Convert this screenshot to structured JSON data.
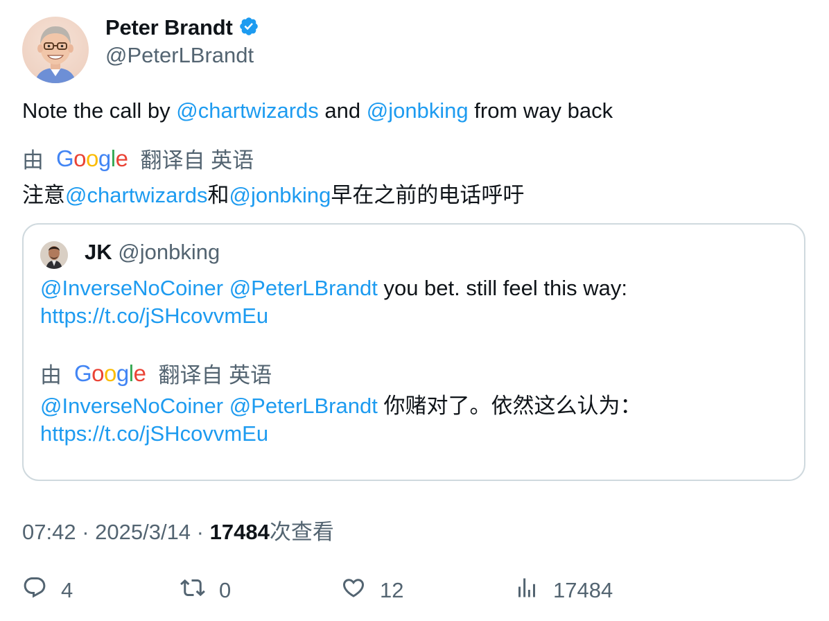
{
  "author": {
    "name": "Peter Brandt",
    "handle": "@PeterLBrandt",
    "verified_icon": "verified-badge-icon"
  },
  "tweet": {
    "text_1": "Note the call by ",
    "mention_1": "@chartwizards",
    "text_2": " and ",
    "mention_2": "@jonbking",
    "text_3": " from way back"
  },
  "translation": {
    "by": "由",
    "provider": "Google",
    "from_label": "翻译自 英语",
    "t_1": "注意",
    "mention_1": "@chartwizards",
    "t_2": "和",
    "mention_2": "@jonbking",
    "t_3": "早在之前的电话呼吁"
  },
  "quote": {
    "name": "JK",
    "handle": "@jonbking",
    "mention_1": "@InverseNoCoiner",
    "mention_2": "@PeterLBrandt",
    "text": " you bet. still feel this way:",
    "url": "https://t.co/jSHcovvmEu",
    "translation_by": "由",
    "translation_provider": "Google",
    "translation_from": "翻译自 英语",
    "translated_mention_1": "@InverseNoCoiner",
    "translated_mention_2": "@PeterLBrandt",
    "translated_text": " 你赌对了。依然这么认为：",
    "translated_url": "https://t.co/jSHcovvmEu"
  },
  "meta": {
    "time": "07:42",
    "sep_1": " · ",
    "date": "2025/3/14",
    "sep_2": " · ",
    "views": "17484",
    "views_label": "次查看"
  },
  "actions": {
    "replies": "4",
    "reposts": "0",
    "likes": "12",
    "views": "17484"
  },
  "colors": {
    "link": "#1d9bf0",
    "muted": "#536471",
    "text": "#0f1419",
    "border": "#cfd9de"
  }
}
